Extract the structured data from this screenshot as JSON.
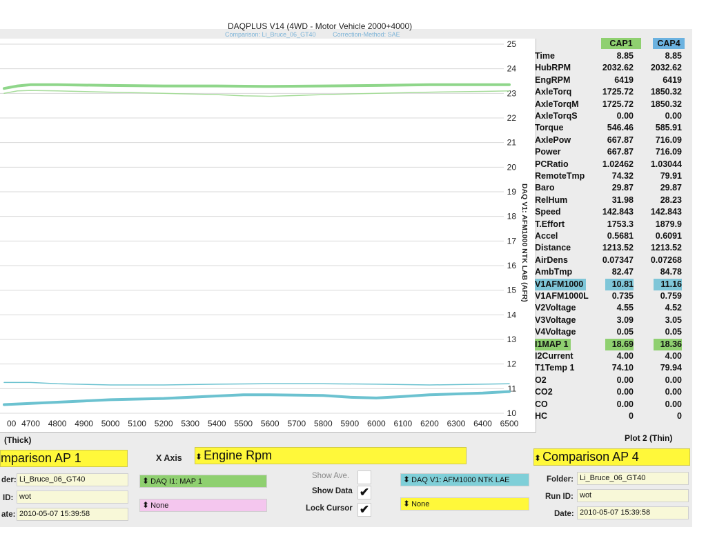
{
  "window": {
    "title": "DAQPLUS V14 (4WD - Motor Vehicle 2000+4000)",
    "comparison_label": "Comparison: Li_Bruce_06_GT40",
    "correction_label": "Correction-Method: SAE"
  },
  "chart_data": {
    "type": "line",
    "xlabel": "",
    "ylabel": "DAQ V1: AFM1000 NTK LAB (AFR)",
    "xlim": [
      3900,
      6500
    ],
    "ylim": [
      10,
      25
    ],
    "x_ticks": [
      "00",
      "4700",
      "4800",
      "4900",
      "5000",
      "5100",
      "5200",
      "5300",
      "5400",
      "5500",
      "5600",
      "5700",
      "5800",
      "5900",
      "6000",
      "6100",
      "6200",
      "6300",
      "6400",
      "6500"
    ],
    "y_ticks": [
      "25",
      "24",
      "23",
      "22",
      "21",
      "20",
      "19",
      "18",
      "17",
      "16",
      "15",
      "14",
      "13",
      "12",
      "11",
      "10"
    ],
    "grid": true,
    "series": [
      {
        "color": "#8fd68a",
        "width": 4,
        "x": [
          4600,
          4650,
          4700,
          4800,
          5000,
          5200,
          5400,
          5600,
          5800,
          6000,
          6200,
          6400,
          6500
        ],
        "y": [
          23.2,
          23.3,
          23.35,
          23.35,
          23.32,
          23.3,
          23.3,
          23.28,
          23.3,
          23.32,
          23.35,
          23.35,
          23.35
        ]
      },
      {
        "color": "#a6dc9a",
        "width": 1.5,
        "x": [
          4600,
          4650,
          4700,
          4800,
          5000,
          5200,
          5400,
          5500,
          5600,
          5800,
          6000,
          6200,
          6400,
          6500
        ],
        "y": [
          23.0,
          23.1,
          23.12,
          23.1,
          23.05,
          23.0,
          22.95,
          22.9,
          22.88,
          22.95,
          23.0,
          23.05,
          23.08,
          23.1
        ]
      },
      {
        "color": "#6cc2d0",
        "width": 4,
        "x": [
          4600,
          4700,
          4800,
          4900,
          5000,
          5200,
          5400,
          5500,
          5600,
          5800,
          5900,
          6000,
          6100,
          6200,
          6400,
          6500
        ],
        "y": [
          10.35,
          10.4,
          10.45,
          10.5,
          10.55,
          10.6,
          10.7,
          10.75,
          10.75,
          10.72,
          10.65,
          10.62,
          10.68,
          10.75,
          10.82,
          10.88
        ]
      },
      {
        "color": "#6cc2d0",
        "width": 1.5,
        "x": [
          4600,
          4700,
          4800,
          5000,
          5200,
          5400,
          5600,
          5800,
          6000,
          6200,
          6400,
          6500
        ],
        "y": [
          11.25,
          11.25,
          11.2,
          11.15,
          11.15,
          11.18,
          11.2,
          11.2,
          11.18,
          11.15,
          11.18,
          11.2
        ]
      }
    ]
  },
  "datatable": {
    "col1": "CAP1",
    "col2": "CAP4",
    "col1_color": "#8fd070",
    "col2_color": "#6bb2e0",
    "rows": [
      {
        "label": "Time",
        "v1": "8.85",
        "v2": "8.85"
      },
      {
        "label": "HubRPM",
        "v1": "2032.62",
        "v2": "2032.62"
      },
      {
        "label": "EngRPM",
        "v1": "6419",
        "v2": "6419"
      },
      {
        "label": "AxleTorq",
        "v1": "1725.72",
        "v2": "1850.32"
      },
      {
        "label": "AxleTorqM",
        "v1": "1725.72",
        "v2": "1850.32"
      },
      {
        "label": "AxleTorqS",
        "v1": "0.00",
        "v2": "0.00"
      },
      {
        "label": "Torque",
        "v1": "546.46",
        "v2": "585.91"
      },
      {
        "label": "AxlePow",
        "v1": "667.87",
        "v2": "716.09"
      },
      {
        "label": "Power",
        "v1": "667.87",
        "v2": "716.09"
      },
      {
        "label": "PCRatio",
        "v1": "1.02462",
        "v2": "1.03044"
      },
      {
        "label": "RemoteTmp",
        "v1": "74.32",
        "v2": "79.91"
      },
      {
        "label": "Baro",
        "v1": "29.87",
        "v2": "29.87"
      },
      {
        "label": "RelHum",
        "v1": "31.98",
        "v2": "28.23"
      },
      {
        "label": "Speed",
        "v1": "142.843",
        "v2": "142.843"
      },
      {
        "label": "T.Effort",
        "v1": "1753.3",
        "v2": "1879.9"
      },
      {
        "label": "Accel",
        "v1": "0.5681",
        "v2": "0.6091"
      },
      {
        "label": "Distance",
        "v1": "1213.52",
        "v2": "1213.52"
      },
      {
        "label": "AirDens",
        "v1": "0.07347",
        "v2": "0.07268"
      },
      {
        "label": "AmbTmp",
        "v1": "82.47",
        "v2": "84.78"
      },
      {
        "label": "V1AFM1000",
        "v1": "10.81",
        "v2": "11.16",
        "highlight": "blue"
      },
      {
        "label": "V1AFM1000L",
        "v1": "0.735",
        "v2": "0.759"
      },
      {
        "label": "V2Voltage",
        "v1": "4.55",
        "v2": "4.52"
      },
      {
        "label": "V3Voltage",
        "v1": "3.09",
        "v2": "3.05"
      },
      {
        "label": "V4Voltage",
        "v1": "0.05",
        "v2": "0.05"
      },
      {
        "label": "I1MAP 1",
        "v1": "18.69",
        "v2": "18.36",
        "highlight": "green"
      },
      {
        "label": "I2Current",
        "v1": "4.00",
        "v2": "4.00"
      },
      {
        "label": "T1Temp 1",
        "v1": "74.10",
        "v2": "79.94"
      },
      {
        "label": "O2",
        "v1": "0.00",
        "v2": "0.00"
      },
      {
        "label": "CO2",
        "v1": "0.00",
        "v2": "0.00"
      },
      {
        "label": "CO",
        "v1": "0.00",
        "v2": "0.00"
      },
      {
        "label": "HC",
        "v1": "0",
        "v2": "0"
      }
    ]
  },
  "controls": {
    "plot1_label": "(Thick)",
    "plot2_label": "Plot 2 (Thin)",
    "plot1_source": "mparison AP 1",
    "plot2_source": "Comparison AP 4",
    "xaxis_label": "X Axis",
    "xaxis_value": "Engine Rpm",
    "plot1_folder_label": "der:",
    "plot1_folder": "Li_Bruce_06_GT40",
    "plot1_runid_label": "ID:",
    "plot1_runid": "wot",
    "plot1_date_label": "ate:",
    "plot1_date": "2010-05-07 15:39:58",
    "plot1_channel1": "DAQ I1: MAP 1",
    "plot1_channel2": "None",
    "show_ave": "Show Ave.",
    "show_data": "Show Data",
    "lock_cursor": "Lock Cursor",
    "check_mark": "✔",
    "plot2_channel1": "DAQ V1: AFM1000 NTK LAE",
    "plot2_channel2": "None",
    "plot2_folder_label": "Folder:",
    "plot2_folder": "Li_Bruce_06_GT40",
    "plot2_runid_label": "Run ID:",
    "plot2_runid": "wot",
    "plot2_date_label": "Date:",
    "plot2_date": "2010-05-07 15:39:58",
    "updown_glyph": "⬍",
    "channel1_color": "#8fd070",
    "channel2_color": "#f4c6ee",
    "plot2_channel1_color": "#7fcfd8",
    "highlight_yellow": "#fff83a"
  }
}
